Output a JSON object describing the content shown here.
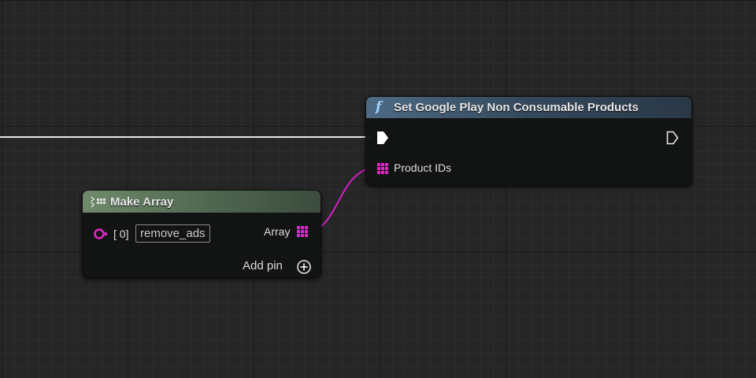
{
  "function_node": {
    "icon": "function-icon",
    "icon_glyph": "f",
    "title": "Set Google Play Non Consumable Products",
    "exec_in_icon": "exec-pin-in-icon",
    "exec_out_icon": "exec-pin-out-icon",
    "pin_label": "Product IDs",
    "pin_icon": "array-pin-icon"
  },
  "make_array_node": {
    "icon": "make-array-icon",
    "title": "Make Array",
    "element_index": "[ 0]",
    "element_value": "remove_ads",
    "output_label": "Array",
    "output_icon": "array-pin-icon",
    "add_pin_label": "Add pin",
    "add_pin_icon": "plus-circle-icon"
  },
  "colors": {
    "background": "#262626",
    "exec_wire": "#ffffff",
    "array_wire": "#d01dc4",
    "string_pin": "#e226c9",
    "function_header": "#4e6b84",
    "make_array_header": "#6f8a6a"
  }
}
